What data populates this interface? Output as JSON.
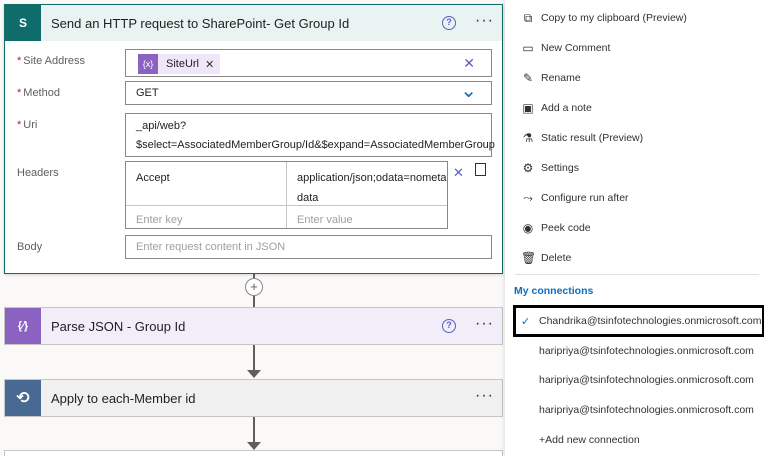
{
  "http_action": {
    "title": "Send an HTTP request to SharePoint- Get Group Id",
    "icon_letter": "S",
    "help_icon": "?",
    "more_icon": "···",
    "site_address_label": "Site Address",
    "site_address_token": "SiteUrl",
    "site_address_token_icon": "{x}",
    "method_label": "Method",
    "method_value": "GET",
    "uri_label": "Uri",
    "uri_line1": "_api/web?",
    "uri_line2": "$select=AssociatedMemberGroup/Id&$expand=AssociatedMemberGroup",
    "headers_label": "Headers",
    "header_key": "Accept",
    "header_value_line1": "application/json;odata=nometa",
    "header_value_line2": "data",
    "header_key_placeholder": "Enter key",
    "header_value_placeholder": "Enter value",
    "body_label": "Body",
    "body_placeholder": "Enter request content in JSON",
    "required_mark": "*",
    "clear_icon": "✕",
    "chevron_icon": "⌄"
  },
  "parse_action": {
    "title": "Parse JSON - Group Id",
    "icon": "{⁄}",
    "help_icon": "?",
    "more_icon": "···"
  },
  "apply_action": {
    "title": "Apply to each-Member id",
    "icon": "⟲",
    "more_icon": "···"
  },
  "plus_icon": "+",
  "menu": {
    "items": [
      {
        "label": "Copy to my clipboard (Preview)",
        "icon": "⧉"
      },
      {
        "label": "New Comment",
        "icon": "▭"
      },
      {
        "label": "Rename",
        "icon": "✎"
      },
      {
        "label": "Add a note",
        "icon": "▣"
      },
      {
        "label": "Static result (Preview)",
        "icon": "⚗"
      },
      {
        "label": "Settings",
        "icon": "⚙"
      },
      {
        "label": "Configure run after",
        "icon": "⤳"
      },
      {
        "label": "Peek code",
        "icon": "◉"
      },
      {
        "label": "Delete",
        "icon": "🗑"
      }
    ],
    "connections_heading": "My connections",
    "connections": [
      {
        "label": "Chandrika@tsinfotechnologies.onmicrosoft.com",
        "check": "✓"
      },
      {
        "label": "haripriya@tsinfotechnologies.onmicrosoft.com",
        "check": ""
      },
      {
        "label": "haripriya@tsinfotechnologies.onmicrosoft.com",
        "check": ""
      },
      {
        "label": "haripriya@tsinfotechnologies.onmicrosoft.com",
        "check": ""
      },
      {
        "label": "+Add new connection",
        "check": ""
      }
    ]
  }
}
